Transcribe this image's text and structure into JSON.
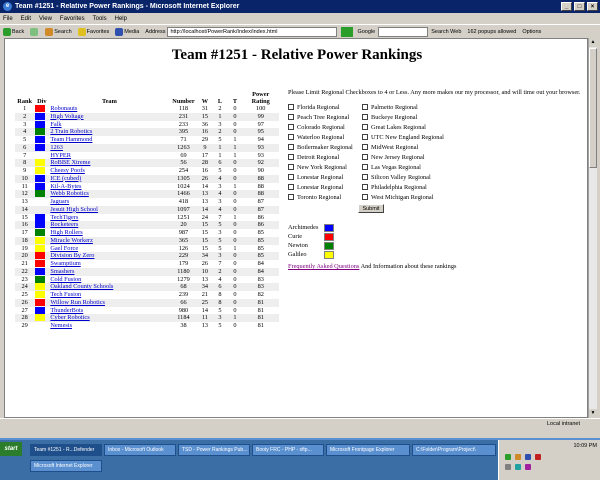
{
  "window": {
    "title": "Team #1251 - Relative Power Rankings - Microsoft Internet Explorer"
  },
  "menu": [
    "File",
    "Edit",
    "View",
    "Favorites",
    "Tools",
    "Help"
  ],
  "toolbar": {
    "back": "Back",
    "search": "Search",
    "favorites": "Favorites",
    "media": "Media",
    "address_label": "Address",
    "address_value": "http://localhost/PowerRank/Index/index.html",
    "google": "Google",
    "search_web": "Search Web",
    "popups": "162 popups allowed",
    "options": "Options"
  },
  "page": {
    "title": "Team #1251 - Relative Power Rankings",
    "headers": {
      "rank": "Rank",
      "div": "Div",
      "team": "Team",
      "number": "Number",
      "w": "W",
      "l": "L",
      "t": "T",
      "power": "Power Rating"
    },
    "rows": [
      {
        "rank": "1",
        "div": "#ff0000",
        "team": "Robonauts",
        "number": "118",
        "w": "31",
        "l": "2",
        "t": "0",
        "pr": "100"
      },
      {
        "rank": "2",
        "div": "#0000ff",
        "team": "High Voltage",
        "number": "231",
        "w": "15",
        "l": "1",
        "t": "0",
        "pr": "99"
      },
      {
        "rank": "3",
        "div": "#0000ff",
        "team": "Falk",
        "number": "233",
        "w": "36",
        "l": "3",
        "t": "0",
        "pr": "97"
      },
      {
        "rank": "4",
        "div": "#008000",
        "team": "2 Train Robotics",
        "number": "395",
        "w": "16",
        "l": "2",
        "t": "0",
        "pr": "95"
      },
      {
        "rank": "5",
        "div": "#0000ff",
        "team": "Team Hammond",
        "number": "71",
        "w": "29",
        "l": "5",
        "t": "1",
        "pr": "94"
      },
      {
        "rank": "6",
        "div": "#0000ff",
        "team": "1263",
        "number": "1263",
        "w": "9",
        "l": "1",
        "t": "1",
        "pr": "93"
      },
      {
        "rank": "7",
        "div": "",
        "team": "HYPER",
        "number": "69",
        "w": "17",
        "l": "1",
        "t": "1",
        "pr": "93"
      },
      {
        "rank": "8",
        "div": "#ffff00",
        "team": "RoBBE Xtreme",
        "number": "56",
        "w": "28",
        "l": "6",
        "t": "0",
        "pr": "92"
      },
      {
        "rank": "9",
        "div": "#ffff00",
        "team": "Cheesy Poofs",
        "number": "254",
        "w": "16",
        "l": "5",
        "t": "0",
        "pr": "90"
      },
      {
        "rank": "10",
        "div": "#0000ff",
        "team": "ICE (cubed)",
        "number": "1305",
        "w": "26",
        "l": "4",
        "t": "0",
        "pr": "88"
      },
      {
        "rank": "11",
        "div": "#0000ff",
        "team": "Kil-A-Bytes",
        "number": "1024",
        "w": "14",
        "l": "3",
        "t": "1",
        "pr": "88"
      },
      {
        "rank": "12",
        "div": "#008000",
        "team": "Webb Robotics",
        "number": "1466",
        "w": "13",
        "l": "4",
        "t": "0",
        "pr": "88"
      },
      {
        "rank": "13",
        "div": "",
        "team": "Jaguars",
        "number": "418",
        "w": "13",
        "l": "3",
        "t": "0",
        "pr": "87"
      },
      {
        "rank": "14",
        "div": "",
        "team": "Jesuit High School",
        "number": "1097",
        "w": "14",
        "l": "4",
        "t": "0",
        "pr": "87"
      },
      {
        "rank": "15",
        "div": "#0000ff",
        "team": "TechTigers",
        "number": "1251",
        "w": "24",
        "l": "7",
        "t": "1",
        "pr": "86"
      },
      {
        "rank": "16",
        "div": "#0000ff",
        "team": "Rocketeers",
        "number": "20",
        "w": "15",
        "l": "5",
        "t": "0",
        "pr": "86"
      },
      {
        "rank": "17",
        "div": "#008000",
        "team": "High Rollers",
        "number": "987",
        "w": "15",
        "l": "3",
        "t": "0",
        "pr": "85"
      },
      {
        "rank": "18",
        "div": "#ffff00",
        "team": "Miracle Workerz",
        "number": "365",
        "w": "15",
        "l": "5",
        "t": "0",
        "pr": "85"
      },
      {
        "rank": "19",
        "div": "#ffff00",
        "team": "Gael Force",
        "number": "126",
        "w": "15",
        "l": "5",
        "t": "1",
        "pr": "85"
      },
      {
        "rank": "20",
        "div": "#ff0000",
        "team": "Division By Zero",
        "number": "229",
        "w": "34",
        "l": "3",
        "t": "0",
        "pr": "85"
      },
      {
        "rank": "21",
        "div": "#ff0000",
        "team": "Swamptium",
        "number": "179",
        "w": "26",
        "l": "7",
        "t": "0",
        "pr": "84"
      },
      {
        "rank": "22",
        "div": "#0000ff",
        "team": "Smashers",
        "number": "1180",
        "w": "10",
        "l": "2",
        "t": "0",
        "pr": "84"
      },
      {
        "rank": "23",
        "div": "#008000",
        "team": "Cold Fusion",
        "number": "1279",
        "w": "13",
        "l": "4",
        "t": "0",
        "pr": "83"
      },
      {
        "rank": "24",
        "div": "#ffff00",
        "team": "Oakland County Schools",
        "number": "68",
        "w": "34",
        "l": "6",
        "t": "0",
        "pr": "83"
      },
      {
        "rank": "25",
        "div": "#ffff00",
        "team": "Tech Fusion",
        "number": "239",
        "w": "21",
        "l": "8",
        "t": "0",
        "pr": "82"
      },
      {
        "rank": "26",
        "div": "#ff0000",
        "team": "Willow Run Robotics",
        "number": "66",
        "w": "25",
        "l": "8",
        "t": "0",
        "pr": "81"
      },
      {
        "rank": "27",
        "div": "#0000ff",
        "team": "ThunderBots",
        "number": "980",
        "w": "14",
        "l": "5",
        "t": "0",
        "pr": "81"
      },
      {
        "rank": "28",
        "div": "#ffff00",
        "team": "Cyber Robotics",
        "number": "1184",
        "w": "11",
        "l": "3",
        "t": "1",
        "pr": "81"
      },
      {
        "rank": "29",
        "div": "",
        "team": "Nemesis",
        "number": "38",
        "w": "13",
        "l": "5",
        "t": "0",
        "pr": "81"
      }
    ],
    "intro": "Please Limit Regional Checkboxes to 4 or Less. Any more makes our my processor, and will time out your browser.",
    "regionals": [
      "Florida Regional",
      "Palmetto Regional",
      "Peach Tree Regional",
      "Buckeye Regional",
      "Colorado Regional",
      "Great Lakes Regional",
      "Waterloo Regional",
      "UTC New England Regional",
      "Boilermaker Regional",
      "MidWest Regional",
      "Detroit Regional",
      "New Jersey Regional",
      "New York Regional",
      "Las Vegas Regional",
      "Lonestar Regional",
      "Silicon Valley Regional",
      "Lonestar Regional",
      "Philadelphia Regional",
      "Toronto Regional",
      "West Michigan Regional"
    ],
    "submit_label": "Submit",
    "legend": [
      {
        "name": "Archimedes",
        "color": "#0000ff"
      },
      {
        "name": "Curie",
        "color": "#ff0000"
      },
      {
        "name": "Newton",
        "color": "#008000"
      },
      {
        "name": "Galileo",
        "color": "#ffff00"
      }
    ],
    "faq_link": "Frequently Asked Questions",
    "faq_text": " And Information about these rankings"
  },
  "status": {
    "left": "",
    "zone": "Local intranet"
  },
  "taskbar": {
    "start": "start",
    "tasks": [
      "Team #1251 - R...Defender",
      "Inbox - Microsoft Outlook",
      "TSD - Power Rankings Pub...",
      "Booty FRC - PHP - sftp...",
      "Microsoft Frontpage Explorer",
      "C:\\Folder\\Program\\Project\\",
      "Microsoft Internet Explorer"
    ],
    "clock": "10:09 PM"
  }
}
